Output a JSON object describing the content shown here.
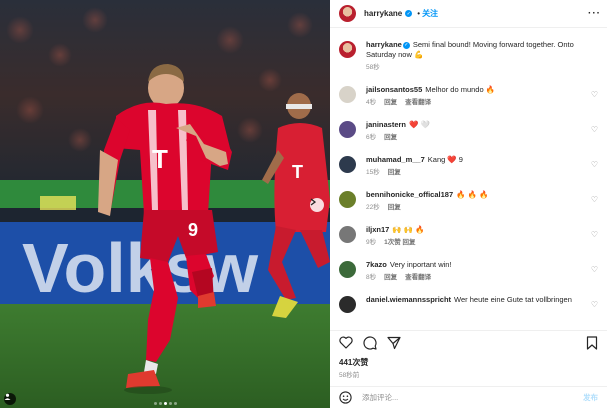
{
  "post": {
    "author": "harrykane",
    "follow_label": "关注",
    "separator": "•",
    "more_icon": "more-horizontal-icon",
    "caption": "Semi final bound! Moving forward together. Onto Saturday now 💪",
    "caption_time": "58秒",
    "likes": "441次赞",
    "time": "58秒前",
    "photo_dots": {
      "count": 5,
      "active": 2
    },
    "photo_banner_text": "Volksw"
  },
  "comments": [
    {
      "user": "jailsonsantos55",
      "text": "Melhor do mundo 🔥",
      "time": "4秒",
      "reply": "回复",
      "translate": "查看翻译",
      "avatar_color": "#d8d3c9"
    },
    {
      "user": "janinastern",
      "text": "❤️ 🤍",
      "time": "6秒",
      "reply": "回复",
      "translate": "",
      "avatar_color": "#5b4b86"
    },
    {
      "user": "muhamad_m__7",
      "text": "Kang ❤️ 9",
      "time": "15秒",
      "reply": "回复",
      "translate": "",
      "avatar_color": "#2d3a4d"
    },
    {
      "user": "bennihonicke_offical187",
      "text": "🔥 🔥 🔥",
      "time": "22秒",
      "reply": "回复",
      "translate": "",
      "avatar_color": "#6b7f2a"
    },
    {
      "user": "iljxn17",
      "text": "🙌 🙌 🔥",
      "time": "9秒",
      "reply": "1次赞   回复",
      "translate": "",
      "avatar_color": "#777777"
    },
    {
      "user": "7kazo",
      "text": "Very inportant win!",
      "time": "8秒",
      "reply": "回复",
      "translate": "查看翻译",
      "avatar_color": "#3c6a3a"
    },
    {
      "user": "daniel.wiemannsspricht",
      "text": "Wer heute eine Gute tat vollbringen",
      "time": "",
      "reply": "",
      "translate": "",
      "avatar_color": "#2b2b2b"
    }
  ],
  "actions": {
    "like_icon": "heart-icon",
    "comment_icon": "comment-icon",
    "share_icon": "share-icon",
    "save_icon": "bookmark-icon"
  },
  "add_comment": {
    "placeholder": "添加评论...",
    "publish_label": "发布",
    "emoji_icon": "emoji-icon"
  },
  "colors": {
    "accent": "#0095f6",
    "kit_red": "#dc052d",
    "pitch_green": "#3f7f2f"
  }
}
